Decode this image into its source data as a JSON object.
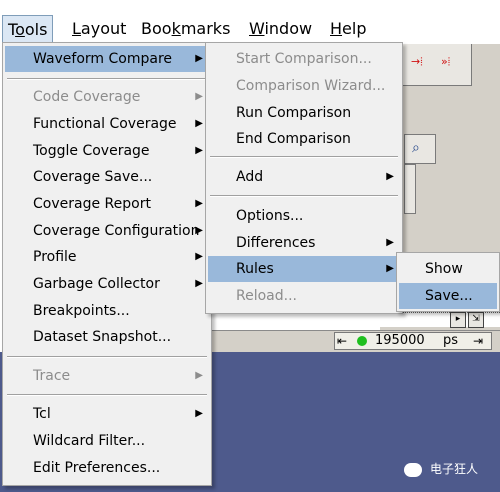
{
  "menubar": {
    "items": [
      "Tools",
      "Layout",
      "Bookmarks",
      "Window",
      "Help"
    ],
    "mnemonics": [
      "o",
      "L",
      "k",
      "W",
      "H"
    ]
  },
  "tools_menu": {
    "items": [
      {
        "label": "Waveform Compare",
        "submenu": true,
        "enabled": true,
        "highlighted": true
      },
      {
        "label": "Code Coverage",
        "submenu": true,
        "enabled": false
      },
      {
        "label": "Functional Coverage",
        "submenu": true,
        "enabled": true
      },
      {
        "label": "Toggle Coverage",
        "submenu": true,
        "enabled": true
      },
      {
        "label": "Coverage Save...",
        "submenu": false,
        "enabled": true
      },
      {
        "label": "Coverage Report",
        "submenu": true,
        "enabled": true
      },
      {
        "label": "Coverage Configuration",
        "submenu": true,
        "enabled": true
      },
      {
        "label": "Profile",
        "submenu": true,
        "enabled": true
      },
      {
        "label": "Garbage Collector",
        "submenu": true,
        "enabled": true
      },
      {
        "label": "Breakpoints...",
        "submenu": false,
        "enabled": true
      },
      {
        "label": "Dataset Snapshot...",
        "submenu": false,
        "enabled": true
      },
      {
        "label": "Trace",
        "submenu": true,
        "enabled": false
      },
      {
        "label": "Tcl",
        "submenu": true,
        "enabled": true
      },
      {
        "label": "Wildcard Filter...",
        "submenu": false,
        "enabled": true
      },
      {
        "label": "Edit Preferences...",
        "submenu": false,
        "enabled": true
      }
    ]
  },
  "waveform_compare_menu": {
    "items": [
      {
        "label": "Start Comparison...",
        "submenu": false,
        "enabled": false
      },
      {
        "label": "Comparison Wizard...",
        "submenu": false,
        "enabled": false
      },
      {
        "label": "Run Comparison",
        "submenu": false,
        "enabled": true
      },
      {
        "label": "End Comparison",
        "submenu": false,
        "enabled": true
      },
      {
        "label": "Add",
        "submenu": true,
        "enabled": true
      },
      {
        "label": "Options...",
        "submenu": false,
        "enabled": true
      },
      {
        "label": "Differences",
        "submenu": true,
        "enabled": true
      },
      {
        "label": "Rules",
        "submenu": true,
        "enabled": true,
        "highlighted": true
      },
      {
        "label": "Reload...",
        "submenu": false,
        "enabled": false
      }
    ]
  },
  "rules_menu": {
    "items": [
      {
        "label": "Show",
        "enabled": true
      },
      {
        "label": "Save...",
        "enabled": true,
        "highlighted": true
      }
    ]
  },
  "status": {
    "time_value": "195000",
    "time_unit": "ps"
  },
  "watermark": {
    "text": "电子狂人"
  },
  "colors": {
    "menu_bg": "#f0f0f0",
    "highlight": "#99b8da",
    "disabled_text": "#8c8c8c",
    "wave_area_bg": "#4e5a8c",
    "toolbar_bg": "#d4d0c8",
    "status_indicator": "#1fbf1f"
  }
}
